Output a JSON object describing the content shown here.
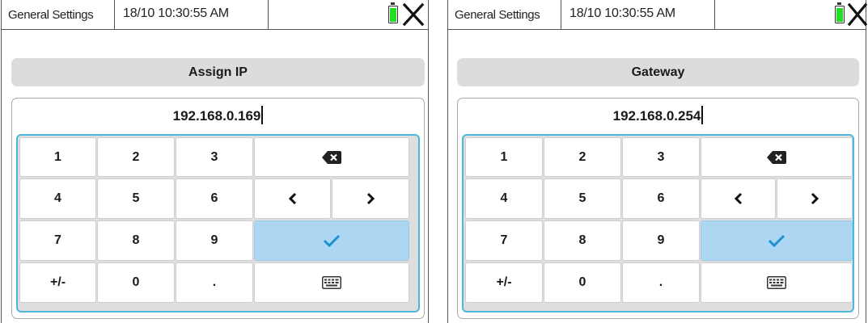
{
  "colors": {
    "battery": "#22dd22",
    "keypad_border": "#4bb8dc",
    "confirm_key": "#acd6f2",
    "checkmark": "#1e8fd0",
    "title_bar": "#dcdcdc"
  },
  "screens": [
    {
      "header": {
        "title": "General Settings",
        "datetime": "18/10 10:30:55 AM",
        "battery_icon": "battery-icon",
        "close_icon": "close-icon"
      },
      "field_title": "Assign IP",
      "value": "192.168.0.169",
      "keys": {
        "k1": "1",
        "k2": "2",
        "k3": "3",
        "k4": "4",
        "k5": "5",
        "k6": "6",
        "k7": "7",
        "k8": "8",
        "k9": "9",
        "sign": "+/-",
        "k0": "0",
        "dot": ".",
        "backspace_icon": "backspace-icon",
        "left_icon": "chevron-left-icon",
        "right_icon": "chevron-right-icon",
        "confirm_icon": "checkmark-icon",
        "keyboard_icon": "keyboard-icon"
      }
    },
    {
      "header": {
        "title": "General Settings",
        "datetime": "18/10 10:30:55 AM",
        "battery_icon": "battery-icon",
        "close_icon": "close-icon"
      },
      "field_title": "Gateway",
      "value": "192.168.0.254",
      "keys": {
        "k1": "1",
        "k2": "2",
        "k3": "3",
        "k4": "4",
        "k5": "5",
        "k6": "6",
        "k7": "7",
        "k8": "8",
        "k9": "9",
        "sign": "+/-",
        "k0": "0",
        "dot": ".",
        "backspace_icon": "backspace-icon",
        "left_icon": "chevron-left-icon",
        "right_icon": "chevron-right-icon",
        "confirm_icon": "checkmark-icon",
        "keyboard_icon": "keyboard-icon"
      }
    }
  ]
}
